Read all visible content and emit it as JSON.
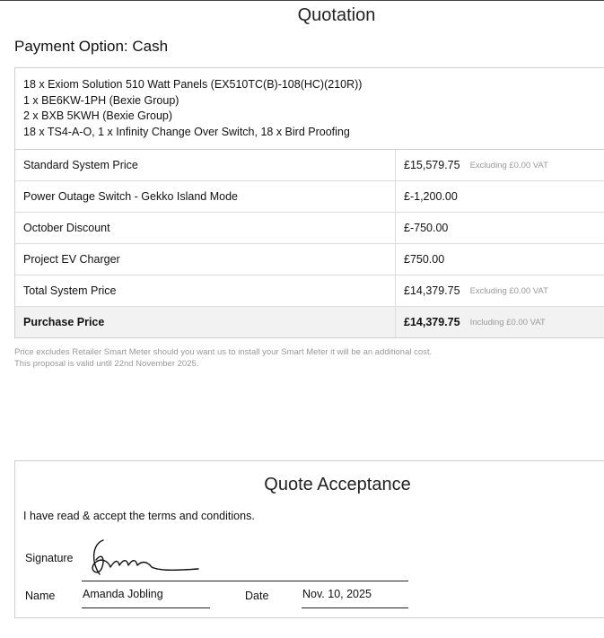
{
  "header": {
    "title": "Quotation",
    "subtitle": "Payment Option: Cash"
  },
  "items": [
    "18 x Exiom Solution 510 Watt Panels (EX510TC(B)-108(HC)(210R))",
    "1 x BE6KW-1PH (Bexie Group)",
    "2 x BXB 5KWH (Bexie Group)",
    "18 x TS4-A-O, 1 x Infinity Change Over Switch, 18 x Bird Proofing"
  ],
  "rows": [
    {
      "label": "Standard System Price",
      "value": "£15,579.75",
      "vat": "Excluding £0.00 VAT"
    },
    {
      "label": "Power Outage Switch - Gekko Island Mode",
      "value": "£-1,200.00",
      "vat": ""
    },
    {
      "label": "October Discount",
      "value": "£-750.00",
      "vat": ""
    },
    {
      "label": "Project EV Charger",
      "value": "£750.00",
      "vat": ""
    },
    {
      "label": "Total System Price",
      "value": "£14,379.75",
      "vat": "Excluding £0.00 VAT"
    },
    {
      "label": "Purchase Price",
      "value": "£14,379.75",
      "vat": "Including £0.00 VAT"
    }
  ],
  "notes": [
    "Price excludes Retailer Smart Meter should you want us to install your Smart Meter it will be an additional cost.",
    "This proposal is valid until 22nd November 2025."
  ],
  "acceptance": {
    "title": "Quote Acceptance",
    "text": "I have read & accept the terms and conditions.",
    "signature_label": "Signature",
    "name_label": "Name",
    "name_value": "Amanda Jobling",
    "date_label": "Date",
    "date_value": "Nov. 10, 2025"
  }
}
